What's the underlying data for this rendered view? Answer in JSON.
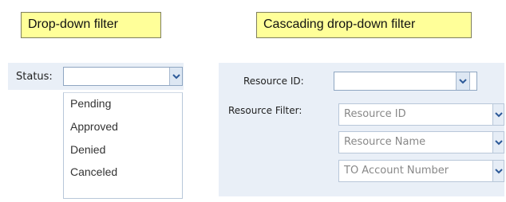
{
  "callouts": {
    "dropdown": "Drop-down filter",
    "cascading": "Cascading drop-down filter"
  },
  "status_filter": {
    "label": "Status:",
    "value": "",
    "options": [
      "Pending",
      "Approved",
      "Denied",
      "Canceled"
    ]
  },
  "cascading_filter": {
    "resource_id_label": "Resource ID:",
    "resource_id_value": "",
    "resource_filter_label": "Resource Filter:",
    "filters": [
      "Resource ID",
      "Resource Name",
      "TO Account Number"
    ]
  },
  "colors": {
    "callout_bg": "#ffff99",
    "panel_bg": "#e9eff7",
    "select_border": "#8fa6c2"
  },
  "icons": {
    "dropdown_arrow": "chevron-down-icon"
  }
}
